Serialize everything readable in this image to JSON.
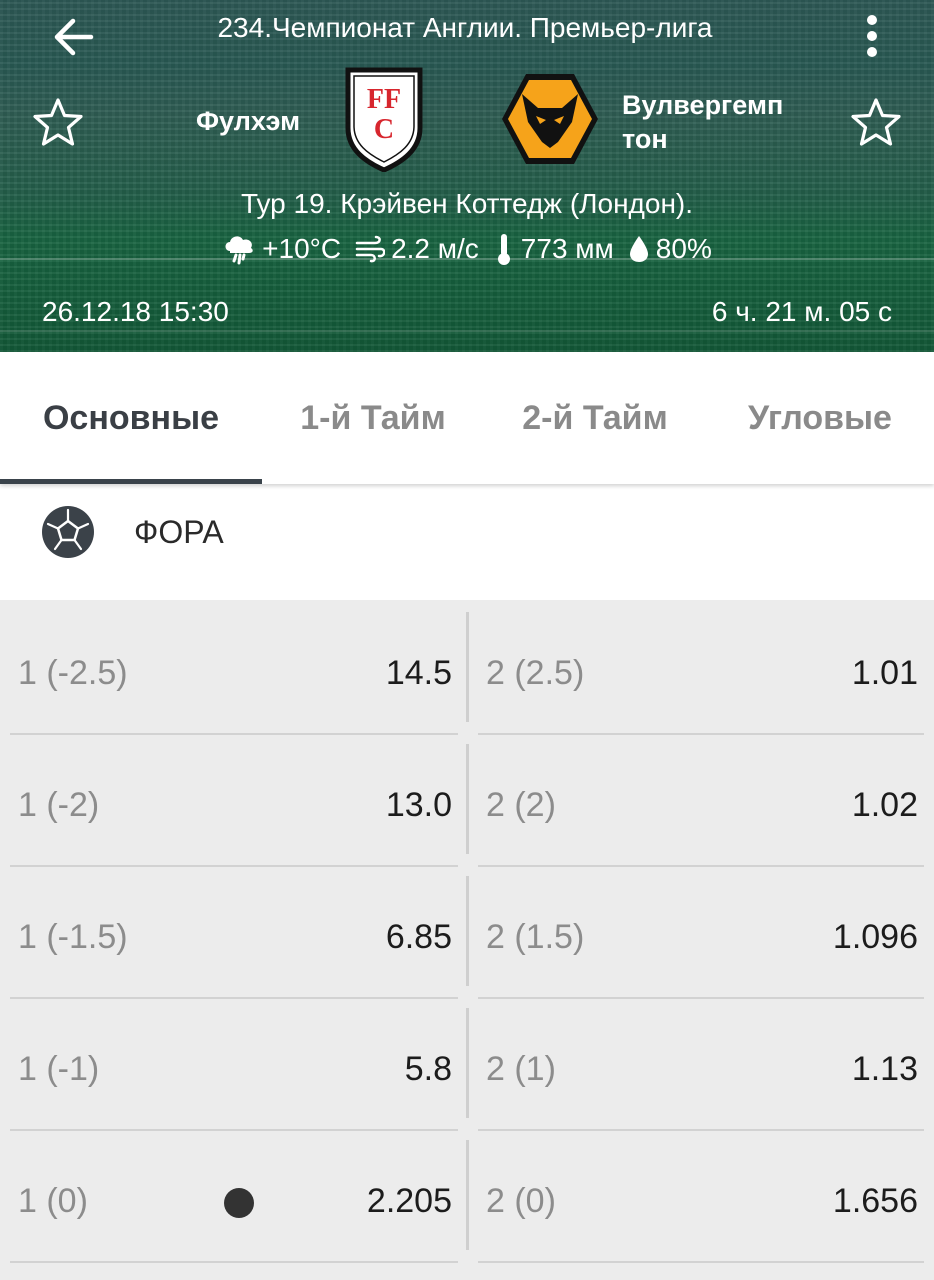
{
  "header": {
    "league_title": "234.Чемпионат Англии. Премьер-лига",
    "home_team": "Фулхэм",
    "away_team_line1": "Вулвергемп",
    "away_team_line2": "тон",
    "tour_venue": "Тур 19. Крэйвен Коттедж (Лондон).",
    "weather": {
      "temperature": "+10°C",
      "wind": "2.2 м/с",
      "pressure": "773 мм",
      "humidity": "80%"
    },
    "start_datetime": "26.12.18 15:30",
    "countdown": "6 ч. 21 м. 05 с",
    "icons": {
      "back": "arrow-back-icon",
      "more": "more-vert-icon",
      "favorite": "star-outline-icon",
      "weather": "cloud-rain-icon",
      "wind": "wind-icon",
      "pressure": "thermometer-icon",
      "humidity": "water-drop-icon"
    }
  },
  "tabs": [
    {
      "label": "Основные",
      "active": true
    },
    {
      "label": "1-й  Тайм",
      "active": false
    },
    {
      "label": "2-й  Тайм",
      "active": false
    },
    {
      "label": "Угловые",
      "active": false
    }
  ],
  "section": {
    "title": "ФОРА",
    "icon": "soccer-ball-icon"
  },
  "odds": [
    {
      "left_label": "1 (-2.5)",
      "left_value": "14.5",
      "right_label": "2 (2.5)",
      "right_value": "1.01"
    },
    {
      "left_label": "1 (-2)",
      "left_value": "13.0",
      "right_label": "2 (2)",
      "right_value": "1.02"
    },
    {
      "left_label": "1 (-1.5)",
      "left_value": "6.85",
      "right_label": "2 (1.5)",
      "right_value": "1.096"
    },
    {
      "left_label": "1 (-1)",
      "left_value": "5.8",
      "right_label": "2 (1)",
      "right_value": "1.13"
    },
    {
      "left_label": "1 (0)",
      "left_value": "2.205",
      "right_label": "2 (0)",
      "right_value": "1.656"
    }
  ],
  "colors": {
    "tab_active_text": "#3a3f45",
    "tab_inactive_text": "#8a8a8a",
    "tab_indicator": "#3a434b",
    "odds_background": "#ececec",
    "wolves_orange": "#f6a31a",
    "fulham_red": "#d7262e"
  }
}
